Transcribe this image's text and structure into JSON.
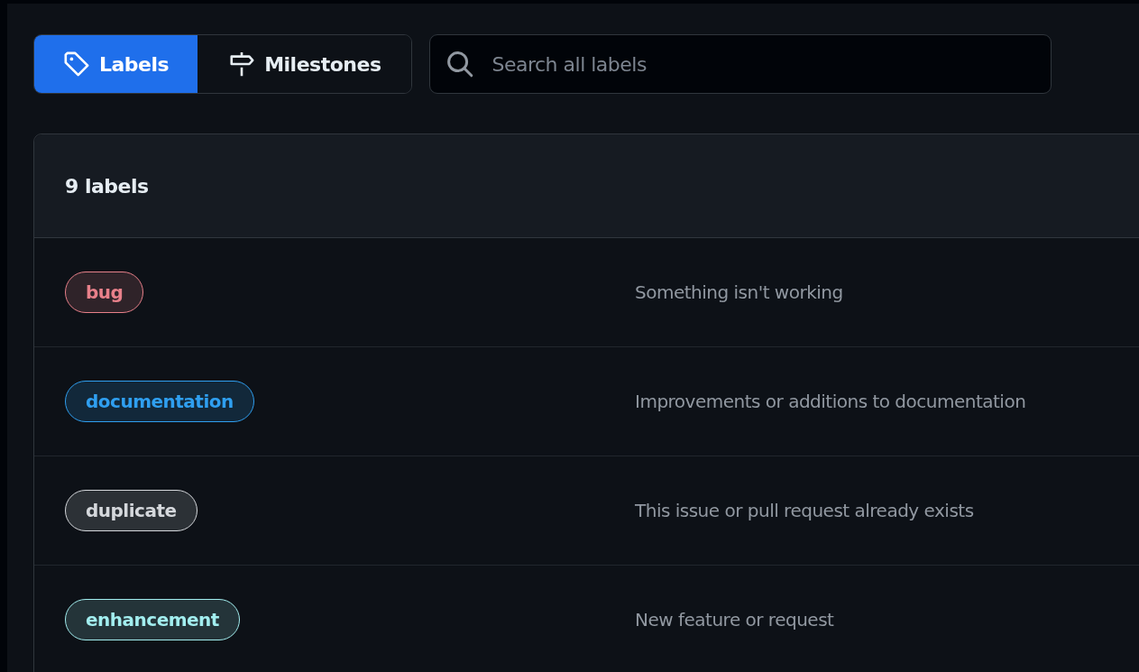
{
  "nav": [
    {
      "label": "Labels",
      "kind": "labels",
      "selected": true
    },
    {
      "label": "Milestones",
      "kind": "milestones",
      "selected": false
    }
  ],
  "search": {
    "placeholder": "Search all labels"
  },
  "header": {
    "count": "9 labels"
  },
  "labels": [
    {
      "name": "bug",
      "color": "#e8808a",
      "description": "Something isn't working"
    },
    {
      "name": "documentation",
      "color": "#2f9ff0",
      "description": "Improvements or additions to documentation"
    },
    {
      "name": "duplicate",
      "color": "#d5d8dc",
      "description": "This issue or pull request already exists"
    },
    {
      "name": "enhancement",
      "color": "#a2eeef",
      "description": "New feature or request"
    }
  ]
}
